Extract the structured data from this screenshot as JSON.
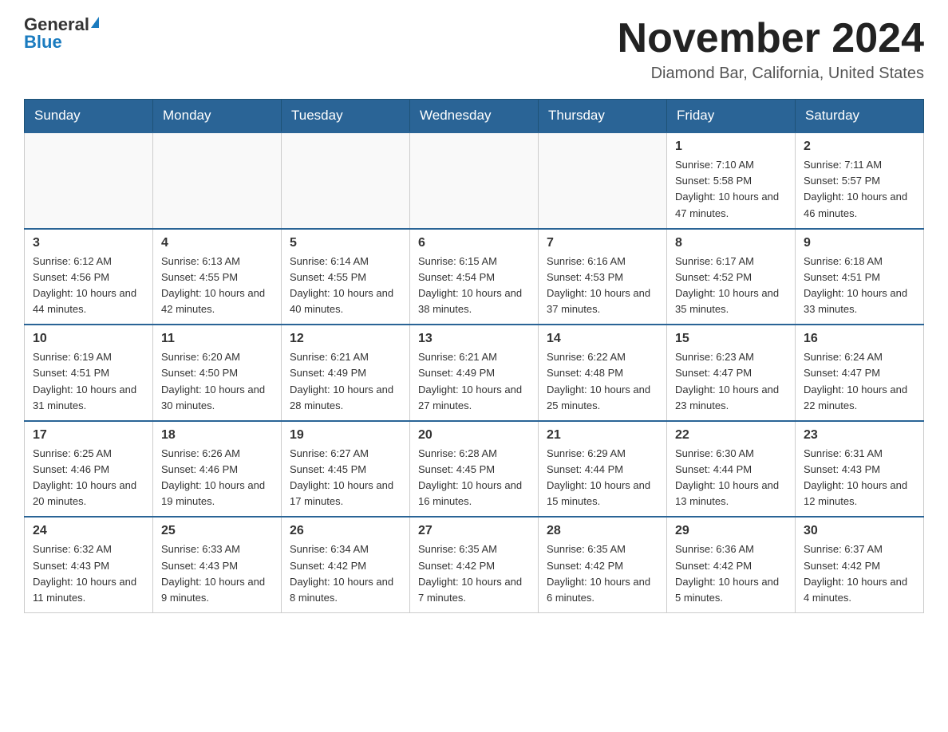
{
  "header": {
    "logo_general": "General",
    "logo_blue": "Blue",
    "month_title": "November 2024",
    "location": "Diamond Bar, California, United States"
  },
  "days_of_week": [
    "Sunday",
    "Monday",
    "Tuesday",
    "Wednesday",
    "Thursday",
    "Friday",
    "Saturday"
  ],
  "weeks": [
    [
      {
        "day": "",
        "info": ""
      },
      {
        "day": "",
        "info": ""
      },
      {
        "day": "",
        "info": ""
      },
      {
        "day": "",
        "info": ""
      },
      {
        "day": "",
        "info": ""
      },
      {
        "day": "1",
        "info": "Sunrise: 7:10 AM\nSunset: 5:58 PM\nDaylight: 10 hours and 47 minutes."
      },
      {
        "day": "2",
        "info": "Sunrise: 7:11 AM\nSunset: 5:57 PM\nDaylight: 10 hours and 46 minutes."
      }
    ],
    [
      {
        "day": "3",
        "info": "Sunrise: 6:12 AM\nSunset: 4:56 PM\nDaylight: 10 hours and 44 minutes."
      },
      {
        "day": "4",
        "info": "Sunrise: 6:13 AM\nSunset: 4:55 PM\nDaylight: 10 hours and 42 minutes."
      },
      {
        "day": "5",
        "info": "Sunrise: 6:14 AM\nSunset: 4:55 PM\nDaylight: 10 hours and 40 minutes."
      },
      {
        "day": "6",
        "info": "Sunrise: 6:15 AM\nSunset: 4:54 PM\nDaylight: 10 hours and 38 minutes."
      },
      {
        "day": "7",
        "info": "Sunrise: 6:16 AM\nSunset: 4:53 PM\nDaylight: 10 hours and 37 minutes."
      },
      {
        "day": "8",
        "info": "Sunrise: 6:17 AM\nSunset: 4:52 PM\nDaylight: 10 hours and 35 minutes."
      },
      {
        "day": "9",
        "info": "Sunrise: 6:18 AM\nSunset: 4:51 PM\nDaylight: 10 hours and 33 minutes."
      }
    ],
    [
      {
        "day": "10",
        "info": "Sunrise: 6:19 AM\nSunset: 4:51 PM\nDaylight: 10 hours and 31 minutes."
      },
      {
        "day": "11",
        "info": "Sunrise: 6:20 AM\nSunset: 4:50 PM\nDaylight: 10 hours and 30 minutes."
      },
      {
        "day": "12",
        "info": "Sunrise: 6:21 AM\nSunset: 4:49 PM\nDaylight: 10 hours and 28 minutes."
      },
      {
        "day": "13",
        "info": "Sunrise: 6:21 AM\nSunset: 4:49 PM\nDaylight: 10 hours and 27 minutes."
      },
      {
        "day": "14",
        "info": "Sunrise: 6:22 AM\nSunset: 4:48 PM\nDaylight: 10 hours and 25 minutes."
      },
      {
        "day": "15",
        "info": "Sunrise: 6:23 AM\nSunset: 4:47 PM\nDaylight: 10 hours and 23 minutes."
      },
      {
        "day": "16",
        "info": "Sunrise: 6:24 AM\nSunset: 4:47 PM\nDaylight: 10 hours and 22 minutes."
      }
    ],
    [
      {
        "day": "17",
        "info": "Sunrise: 6:25 AM\nSunset: 4:46 PM\nDaylight: 10 hours and 20 minutes."
      },
      {
        "day": "18",
        "info": "Sunrise: 6:26 AM\nSunset: 4:46 PM\nDaylight: 10 hours and 19 minutes."
      },
      {
        "day": "19",
        "info": "Sunrise: 6:27 AM\nSunset: 4:45 PM\nDaylight: 10 hours and 17 minutes."
      },
      {
        "day": "20",
        "info": "Sunrise: 6:28 AM\nSunset: 4:45 PM\nDaylight: 10 hours and 16 minutes."
      },
      {
        "day": "21",
        "info": "Sunrise: 6:29 AM\nSunset: 4:44 PM\nDaylight: 10 hours and 15 minutes."
      },
      {
        "day": "22",
        "info": "Sunrise: 6:30 AM\nSunset: 4:44 PM\nDaylight: 10 hours and 13 minutes."
      },
      {
        "day": "23",
        "info": "Sunrise: 6:31 AM\nSunset: 4:43 PM\nDaylight: 10 hours and 12 minutes."
      }
    ],
    [
      {
        "day": "24",
        "info": "Sunrise: 6:32 AM\nSunset: 4:43 PM\nDaylight: 10 hours and 11 minutes."
      },
      {
        "day": "25",
        "info": "Sunrise: 6:33 AM\nSunset: 4:43 PM\nDaylight: 10 hours and 9 minutes."
      },
      {
        "day": "26",
        "info": "Sunrise: 6:34 AM\nSunset: 4:42 PM\nDaylight: 10 hours and 8 minutes."
      },
      {
        "day": "27",
        "info": "Sunrise: 6:35 AM\nSunset: 4:42 PM\nDaylight: 10 hours and 7 minutes."
      },
      {
        "day": "28",
        "info": "Sunrise: 6:35 AM\nSunset: 4:42 PM\nDaylight: 10 hours and 6 minutes."
      },
      {
        "day": "29",
        "info": "Sunrise: 6:36 AM\nSunset: 4:42 PM\nDaylight: 10 hours and 5 minutes."
      },
      {
        "day": "30",
        "info": "Sunrise: 6:37 AM\nSunset: 4:42 PM\nDaylight: 10 hours and 4 minutes."
      }
    ]
  ]
}
